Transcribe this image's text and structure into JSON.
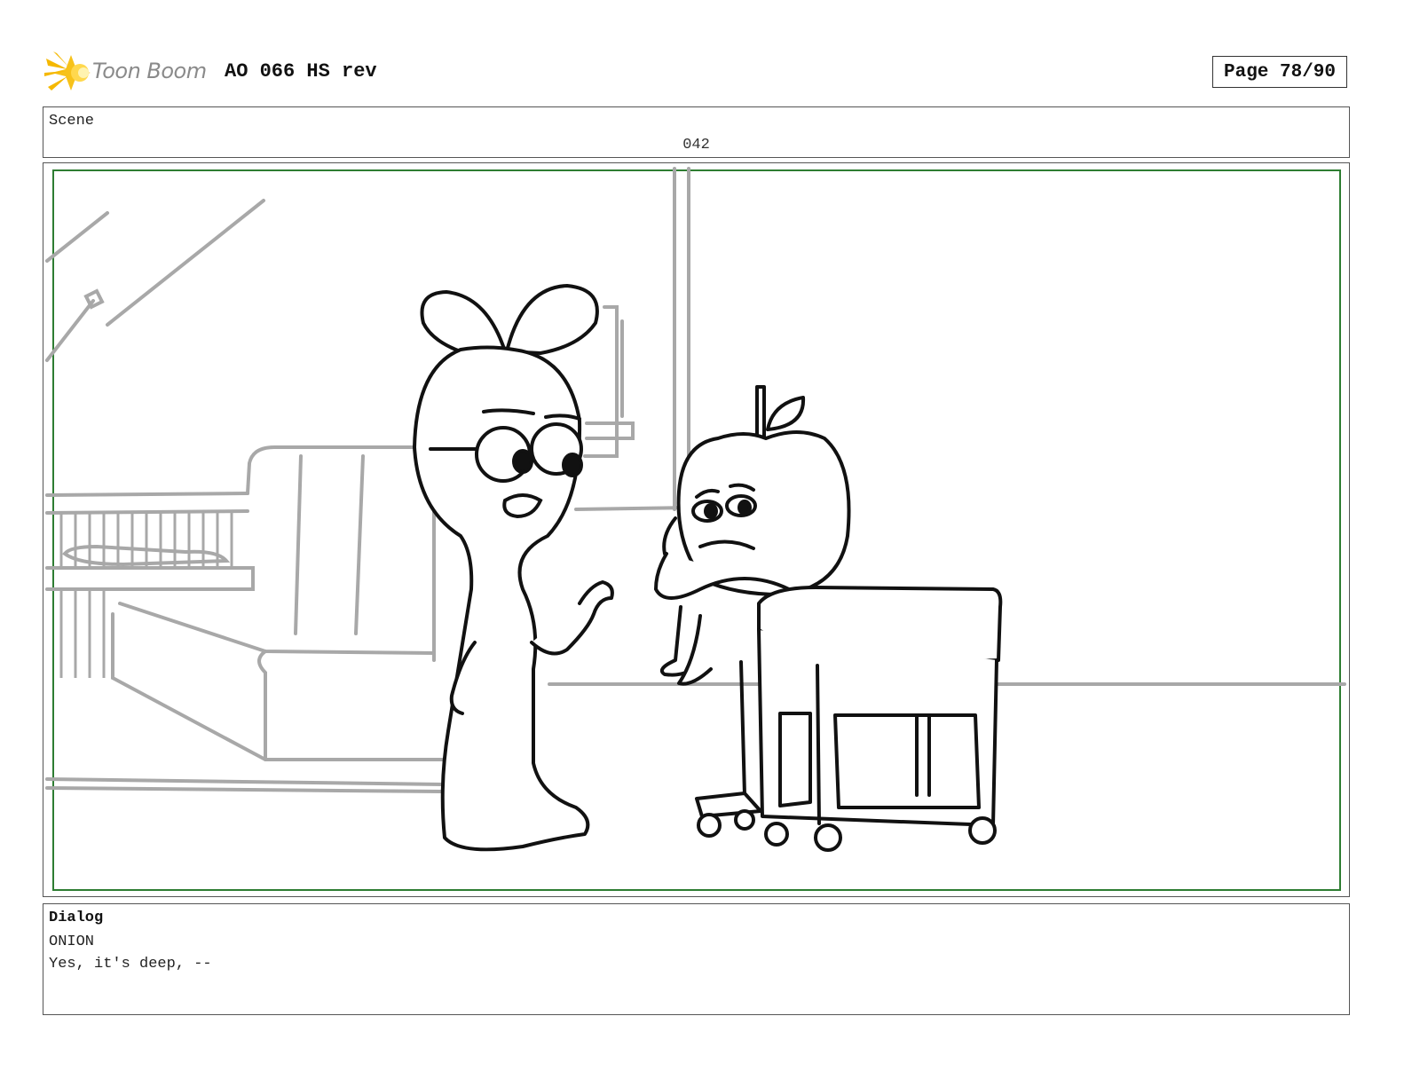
{
  "header": {
    "brand": "Toon Boom",
    "title": "AO 066 HS rev",
    "page_label": "Page 78/90"
  },
  "scene": {
    "label": "Scene",
    "number": "042"
  },
  "panel": {
    "frame_color": "#2e7d32",
    "characters": [
      "rabbit-like character",
      "apple character"
    ]
  },
  "dialog": {
    "header": "Dialog",
    "speaker": "ONION",
    "line": "Yes, it's deep, --"
  }
}
